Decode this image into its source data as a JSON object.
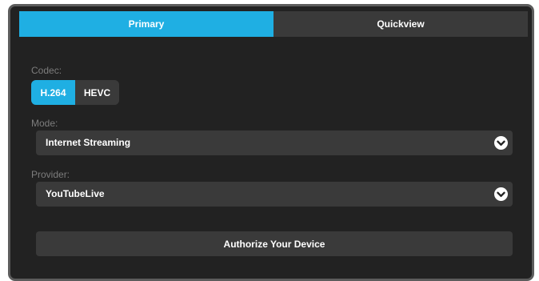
{
  "tabs": {
    "primary": "Primary",
    "quickview": "Quickview",
    "active": "Primary"
  },
  "codec": {
    "label": "Codec:",
    "options": [
      "H.264",
      "HEVC"
    ],
    "selected": "H.264"
  },
  "mode": {
    "label": "Mode:",
    "value": "Internet Streaming",
    "icon": "chevron-down-icon"
  },
  "provider": {
    "label": "Provider:",
    "value": "YouTubeLive",
    "icon": "chevron-down-icon"
  },
  "authorize": {
    "label": "Authorize Your Device"
  },
  "colors": {
    "accent": "#1fafe3",
    "panel_bg": "#222222",
    "control_bg": "#3a3a3a",
    "border": "#5c5c5c",
    "label_text": "#7d7d7d",
    "text": "#ffffff"
  }
}
